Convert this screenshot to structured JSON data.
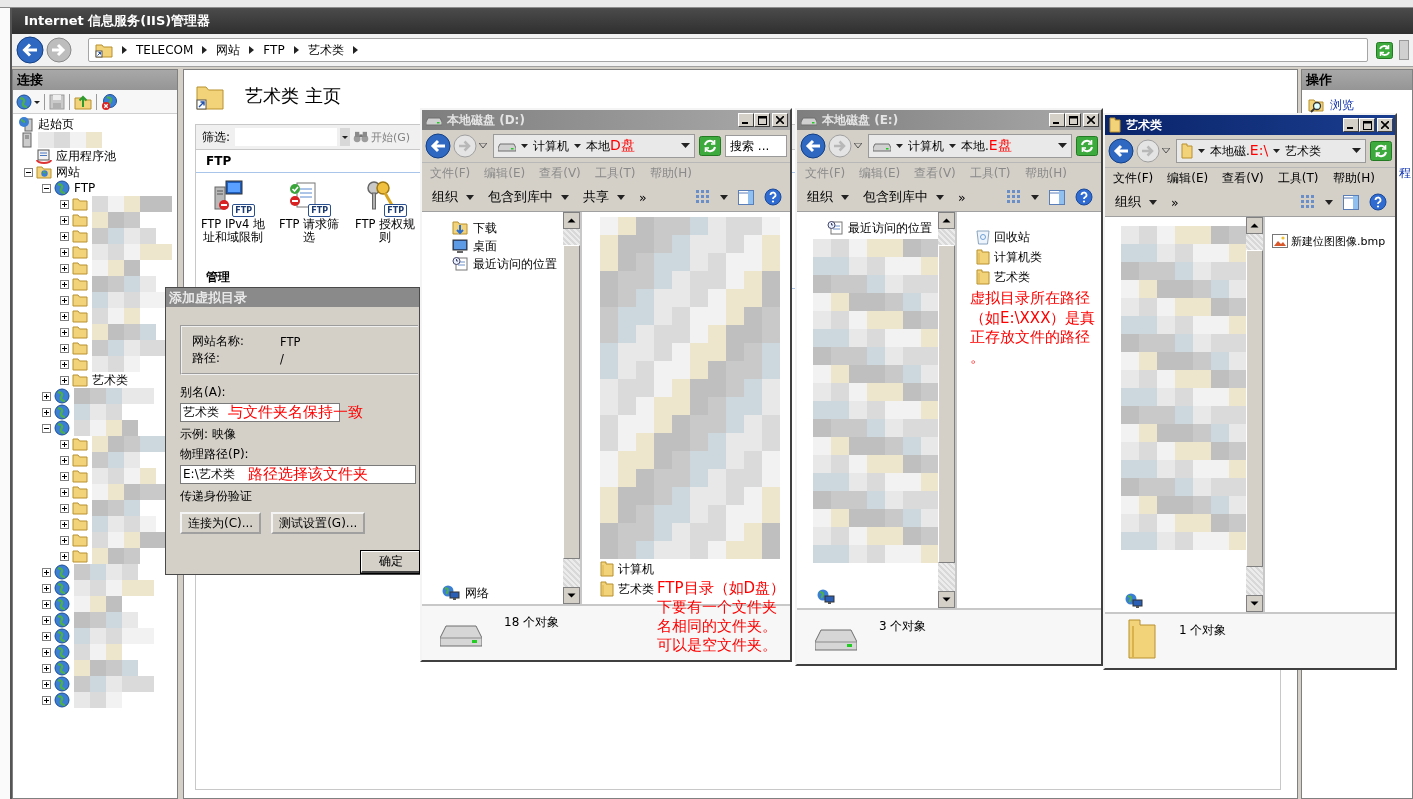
{
  "iis": {
    "title": "Internet 信息服务(IIS)管理器",
    "breadcrumb": [
      "TELECOM",
      "网站",
      "FTP",
      "艺术类"
    ],
    "connections": {
      "title": "连接",
      "tree": [
        {
          "label": "起始页",
          "kind": "start"
        },
        {
          "kind": "server",
          "children": [
            {
              "label": "应用程序池",
              "kind": "pool"
            },
            {
              "label": "网站",
              "kind": "sites",
              "expanded": true,
              "children": [
                {
                  "label": "FTP",
                  "kind": "site",
                  "expanded": true,
                  "children": [
                    {
                      "kind": "folder",
                      "expanded": false
                    },
                    {
                      "kind": "folder",
                      "expanded": false
                    },
                    {
                      "kind": "folder",
                      "expanded": false
                    },
                    {
                      "kind": "folder",
                      "expanded": false
                    },
                    {
                      "kind": "folder",
                      "expanded": false
                    },
                    {
                      "kind": "folder",
                      "expanded": false
                    },
                    {
                      "kind": "folder",
                      "expanded": false
                    },
                    {
                      "kind": "folder",
                      "expanded": false
                    },
                    {
                      "kind": "folder",
                      "expanded": false
                    },
                    {
                      "kind": "folder",
                      "expanded": false
                    },
                    {
                      "kind": "folder",
                      "expanded": false
                    },
                    {
                      "label": "艺术类",
                      "kind": "folder",
                      "expanded": false
                    }
                  ]
                },
                {
                  "kind": "site",
                  "expanded": false
                },
                {
                  "kind": "site",
                  "expanded": false
                },
                {
                  "kind": "site",
                  "expanded": true,
                  "children": [
                    {
                      "kind": "folder",
                      "expanded": false
                    },
                    {
                      "kind": "folder",
                      "expanded": false
                    },
                    {
                      "kind": "folder",
                      "expanded": false
                    },
                    {
                      "kind": "folder",
                      "expanded": false
                    },
                    {
                      "kind": "folder",
                      "expanded": false
                    },
                    {
                      "kind": "folder",
                      "expanded": false
                    },
                    {
                      "kind": "folder",
                      "expanded": false
                    },
                    {
                      "kind": "folder",
                      "expanded": false
                    }
                  ]
                },
                {
                  "kind": "site",
                  "expanded": false
                },
                {
                  "kind": "site",
                  "expanded": false
                },
                {
                  "kind": "site",
                  "expanded": false
                },
                {
                  "kind": "site",
                  "expanded": false
                },
                {
                  "kind": "site",
                  "expanded": false
                },
                {
                  "kind": "site",
                  "expanded": false
                },
                {
                  "kind": "site",
                  "expanded": false
                },
                {
                  "kind": "site",
                  "expanded": false
                },
                {
                  "kind": "site",
                  "expanded": false
                }
              ]
            }
          ]
        }
      ]
    },
    "home": {
      "title": "艺术类 主页",
      "filter_label": "筛选:",
      "go_button": {
        "label": "开始(G)",
        "disabled": true
      },
      "groups": [
        {
          "title": "FTP",
          "features": [
            {
              "label": "FTP IPv4 地址和域限制",
              "kind": "ip_restrictions",
              "tag": "FTP"
            },
            {
              "label": "FTP 请求筛选",
              "kind": "request_filtering",
              "tag": "FTP"
            },
            {
              "label": "FTP 授权规则",
              "kind": "authorization",
              "tag": "FTP"
            }
          ]
        },
        {
          "title": "管理"
        }
      ]
    },
    "actions": {
      "title": "操作",
      "items": [
        {
          "label": "浏览",
          "kind": "link"
        },
        {
          "label": "程",
          "kind": "clipped_link"
        }
      ]
    }
  },
  "dialog": {
    "title": "添加虚拟目录",
    "info": [
      {
        "label": "网站名称:",
        "value": "FTP"
      },
      {
        "label": "路径:",
        "value": "/"
      }
    ],
    "alias": {
      "label": "别名(A):",
      "value": "艺术类",
      "note": "与文件夹名保持一致"
    },
    "example": "示例: 映像",
    "physical_path": {
      "label": "物理路径(P):",
      "value": "E:\\艺术类",
      "note": "路径选择该文件夹"
    },
    "pass_through": "传递身份验证",
    "buttons": [
      "连接为(C)...",
      "测试设置(G)..."
    ],
    "ok_button": "确定"
  },
  "explorers": [
    {
      "title": "本地磁盘 (D:)",
      "kind": "drive",
      "active": false,
      "address": [
        {
          "text": "计算机"
        },
        {
          "text": "本地",
          "note": "D盘"
        }
      ],
      "search_placeholder": "搜索 ...",
      "menu": [
        "文件(F)",
        "编辑(E)",
        "查看(V)",
        "工具(T)",
        "帮助(H)"
      ],
      "toolbar": [
        "组织",
        "包含到库中",
        "共享"
      ],
      "toolbar_more": "»",
      "nav_items": [
        {
          "label": "下载",
          "kind": "downloads"
        },
        {
          "label": "桌面",
          "kind": "desktop"
        },
        {
          "label": "最近访问的位置",
          "kind": "recent"
        },
        {
          "label": "网络",
          "kind": "network"
        }
      ],
      "nav_blurred": false,
      "content_blurred": true,
      "files": [
        {
          "label": "计算机",
          "kind": "folder"
        },
        {
          "label": "艺术类",
          "kind": "folder",
          "note": "FTP目录（如D盘）下要有一个文件夹名相同的文件夹。可以是空文件夹。"
        }
      ],
      "status": "18 个对象"
    },
    {
      "title": "本地磁盘 (E:)",
      "kind": "drive",
      "active": false,
      "address": [
        {
          "text": "计算机"
        },
        {
          "text": "本地.",
          "note": "E盘"
        }
      ],
      "menu": [
        "文件(F)",
        "编辑(E)",
        "查看(V)",
        "工具(T)",
        "帮助(H)"
      ],
      "toolbar": [
        "组织",
        "包含到库中"
      ],
      "toolbar_more": "»",
      "nav_items": [
        {
          "label": "最近访问的位置",
          "kind": "recent"
        },
        {
          "kind": "network"
        }
      ],
      "nav_blurred": true,
      "content_blurred": false,
      "files": [
        {
          "label": "回收站",
          "kind": "recycle_bin"
        },
        {
          "label": "计算机类",
          "kind": "folder"
        },
        {
          "label": "艺术类",
          "kind": "folder"
        }
      ],
      "note": "虚拟目录所在路径（如E:\\XXX）是真正存放文件的路径。",
      "status": "3 个对象"
    },
    {
      "title": "艺术类",
      "kind": "folder",
      "active": true,
      "address": [
        {
          "text": "本地磁.",
          "note": "E:\\"
        },
        {
          "text": "艺术类"
        }
      ],
      "menu": [
        "文件(F)",
        "编辑(E)",
        "查看(V)",
        "工具(T)",
        "帮助(H)"
      ],
      "toolbar": [
        "组织"
      ],
      "toolbar_more": "»",
      "nav_items": [
        {
          "kind": "network"
        }
      ],
      "nav_blurred": true,
      "content_blurred": false,
      "files": [
        {
          "label": "新建位图图像.bmp",
          "kind": "bitmap"
        }
      ],
      "status": "1 个对象"
    }
  ]
}
